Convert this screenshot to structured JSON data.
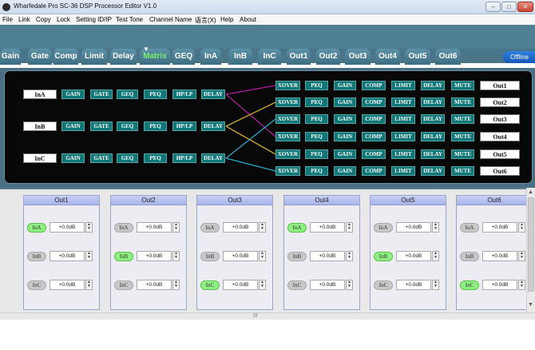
{
  "window": {
    "title": "Wharfedale Pro SC-36 DSP Processor Editor V1.0",
    "controls": {
      "minimize": "–",
      "maximize": "□",
      "close": "✕"
    }
  },
  "menu": [
    "File",
    "Link",
    "Copy",
    "Lock",
    "Setting ID/IP",
    "Test Tone",
    "Channel Name",
    "语言(X)",
    "Help",
    "About"
  ],
  "tabs": [
    "Gain",
    "Gate",
    "Comp",
    "Limit",
    "Delay",
    "Matrix",
    "GEQ",
    "InA",
    "InB",
    "InC",
    "Out1",
    "Out2",
    "Out3",
    "Out4",
    "Out5",
    "Out6"
  ],
  "active_tab": "Matrix",
  "offline_button": "Offline",
  "inputs": [
    {
      "name": "InA",
      "blocks": [
        "GAIN",
        "GATE",
        "GEQ",
        "PEQ",
        "HP/LP",
        "DELAY"
      ]
    },
    {
      "name": "InB",
      "blocks": [
        "GAIN",
        "GATE",
        "GEQ",
        "PEQ",
        "HP/LP",
        "DELAY"
      ]
    },
    {
      "name": "InC",
      "blocks": [
        "GAIN",
        "GATE",
        "GEQ",
        "PEQ",
        "HP/LP",
        "DELAY"
      ]
    }
  ],
  "outputs": [
    {
      "name": "Out1",
      "blocks": [
        "XOVER",
        "PEQ",
        "GAIN",
        "COMP",
        "LIMIT",
        "DELAY",
        "MUTE"
      ]
    },
    {
      "name": "Out2",
      "blocks": [
        "XOVER",
        "PEQ",
        "GAIN",
        "COMP",
        "LIMIT",
        "DELAY",
        "MUTE"
      ]
    },
    {
      "name": "Out3",
      "blocks": [
        "XOVER",
        "PEQ",
        "GAIN",
        "COMP",
        "LIMIT",
        "DELAY",
        "MUTE"
      ]
    },
    {
      "name": "Out4",
      "blocks": [
        "XOVER",
        "PEQ",
        "GAIN",
        "COMP",
        "LIMIT",
        "DELAY",
        "MUTE"
      ]
    },
    {
      "name": "Out5",
      "blocks": [
        "XOVER",
        "PEQ",
        "GAIN",
        "COMP",
        "LIMIT",
        "DELAY",
        "MUTE"
      ]
    },
    {
      "name": "Out6",
      "blocks": [
        "XOVER",
        "PEQ",
        "GAIN",
        "COMP",
        "LIMIT",
        "DELAY",
        "MUTE"
      ]
    }
  ],
  "routing_colors": {
    "InA": "#b01e9a",
    "InB": "#c8a23a",
    "InC": "#2aa9c8"
  },
  "routing": [
    {
      "from": "InA",
      "to": "Out1"
    },
    {
      "from": "InA",
      "to": "Out4"
    },
    {
      "from": "InB",
      "to": "Out2"
    },
    {
      "from": "InB",
      "to": "Out5"
    },
    {
      "from": "InC",
      "to": "Out3"
    },
    {
      "from": "InC",
      "to": "Out6"
    }
  ],
  "mix_panels": [
    {
      "name": "Out1",
      "routes": [
        {
          "input": "InA",
          "on": true,
          "gain": "+0.0dB"
        },
        {
          "input": "InB",
          "on": false,
          "gain": "+0.0dB"
        },
        {
          "input": "InC",
          "on": false,
          "gain": "+0.0dB"
        }
      ]
    },
    {
      "name": "Out2",
      "routes": [
        {
          "input": "InA",
          "on": false,
          "gain": "+0.0dB"
        },
        {
          "input": "InB",
          "on": true,
          "gain": "+0.0dB"
        },
        {
          "input": "InC",
          "on": false,
          "gain": "+0.0dB"
        }
      ]
    },
    {
      "name": "Out3",
      "routes": [
        {
          "input": "InA",
          "on": false,
          "gain": "+0.0dB"
        },
        {
          "input": "InB",
          "on": false,
          "gain": "+0.0dB"
        },
        {
          "input": "InC",
          "on": true,
          "gain": "+0.0dB"
        }
      ]
    },
    {
      "name": "Out4",
      "routes": [
        {
          "input": "InA",
          "on": true,
          "gain": "+0.0dB"
        },
        {
          "input": "InB",
          "on": false,
          "gain": "+0.0dB"
        },
        {
          "input": "InC",
          "on": false,
          "gain": "+0.0dB"
        }
      ]
    },
    {
      "name": "Out5",
      "routes": [
        {
          "input": "InA",
          "on": false,
          "gain": "+0.0dB"
        },
        {
          "input": "InB",
          "on": true,
          "gain": "+0.0dB"
        },
        {
          "input": "InC",
          "on": false,
          "gain": "+0.0dB"
        }
      ]
    },
    {
      "name": "Out6",
      "routes": [
        {
          "input": "InA",
          "on": false,
          "gain": "+0.0dB"
        },
        {
          "input": "InB",
          "on": false,
          "gain": "+0.0dB"
        },
        {
          "input": "InC",
          "on": true,
          "gain": "+0.0dB"
        }
      ]
    }
  ],
  "spinner": {
    "up": "▲",
    "down": "▼"
  },
  "scroll": {
    "up": "▲",
    "down": "▼",
    "grip": "III"
  }
}
